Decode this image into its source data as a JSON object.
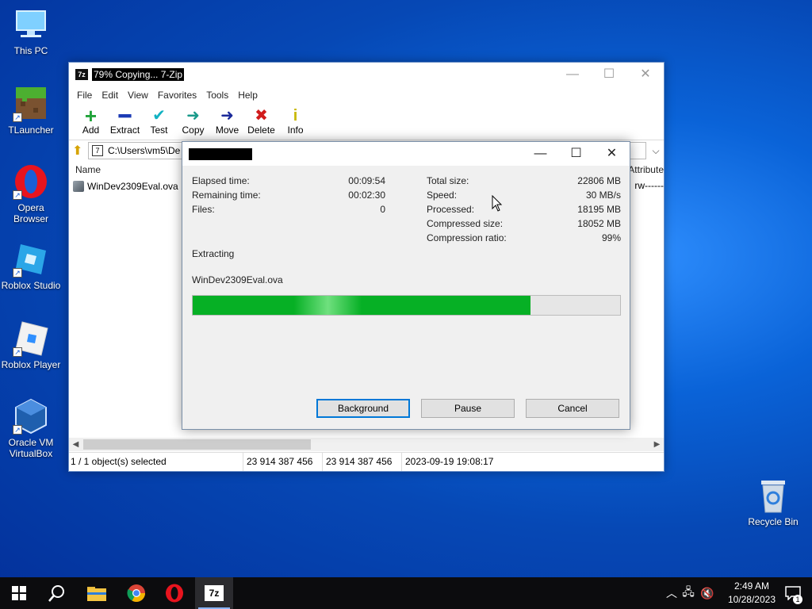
{
  "desktop": {
    "icons": [
      {
        "label": "This PC"
      },
      {
        "label": "TLauncher"
      },
      {
        "label": "Opera Browser"
      },
      {
        "label": "Roblox Studio"
      },
      {
        "label": "Roblox Player"
      },
      {
        "label": "Oracle VM VirtualBox"
      },
      {
        "label": "Recycle Bin"
      }
    ]
  },
  "main_window": {
    "app_icon_text": "7z",
    "title": "79% Copying... 7-Zip",
    "menu": [
      "File",
      "Edit",
      "View",
      "Favorites",
      "Tools",
      "Help"
    ],
    "toolbar": [
      {
        "label": "Add",
        "icon": "plus-icon",
        "color": "#21a33a"
      },
      {
        "label": "Extract",
        "icon": "minus-icon",
        "color": "#1c3bb5"
      },
      {
        "label": "Test",
        "icon": "check-icon",
        "color": "#12b2c2"
      },
      {
        "label": "Copy",
        "icon": "copy-arrow-icon",
        "color": "#1a9a8a"
      },
      {
        "label": "Move",
        "icon": "move-arrow-icon",
        "color": "#1b2a9a"
      },
      {
        "label": "Delete",
        "icon": "delete-x-icon",
        "color": "#d11c1c"
      },
      {
        "label": "Info",
        "icon": "info-icon",
        "color": "#c9b800"
      }
    ],
    "address": "C:\\Users\\vm5\\De",
    "columns": {
      "name": "Name",
      "attributes": "Attribute"
    },
    "files": [
      {
        "name": "WinDev2309Eval.ova",
        "attributes": "rw------"
      }
    ],
    "status": {
      "selection": "1 / 1 object(s) selected",
      "size": "23 914 387 456",
      "packed_size": "23 914 387 456",
      "modified": "2023-09-19 19:08:17"
    }
  },
  "progress_dialog": {
    "left_stats": [
      {
        "label": "Elapsed time:",
        "value": "00:09:54"
      },
      {
        "label": "Remaining time:",
        "value": "00:02:30"
      },
      {
        "label": "Files:",
        "value": "0"
      }
    ],
    "right_stats": [
      {
        "label": "Total size:",
        "value": "22806 MB"
      },
      {
        "label": "Speed:",
        "value": "30 MB/s"
      },
      {
        "label": "Processed:",
        "value": "18195 MB"
      },
      {
        "label": "Compressed size:",
        "value": "18052 MB"
      },
      {
        "label": "Compression ratio:",
        "value": "99%"
      }
    ],
    "operation": "Extracting",
    "current_file": "WinDev2309Eval.ova",
    "progress_fraction": 0.79,
    "progress_color": "#06b025",
    "buttons": {
      "background": "Background",
      "pause": "Pause",
      "cancel": "Cancel"
    }
  },
  "taskbar": {
    "pinned": [
      "start-icon",
      "search-icon",
      "file-explorer-icon",
      "chrome-icon",
      "opera-icon",
      "7zip-icon"
    ],
    "clock_time": "2:49 AM",
    "clock_date": "10/28/2023",
    "notification_count": "1"
  }
}
